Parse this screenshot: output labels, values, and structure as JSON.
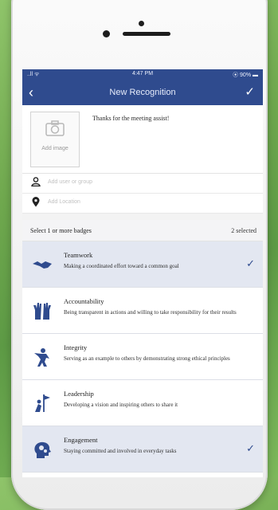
{
  "status_bar": {
    "signal": "..ll ᯤ",
    "time": "4:47 PM",
    "battery": "⦿ 90% ▬"
  },
  "nav": {
    "title": "New Recognition",
    "back_icon": "‹",
    "done_icon": "✓"
  },
  "compose": {
    "add_image_label": "Add image",
    "message": "Thanks for the meeting assist!"
  },
  "fields": {
    "user_placeholder": "Add user or group",
    "location_placeholder": "Add Location"
  },
  "badges_header": {
    "title": "Select 1 or more badges",
    "count": "2 selected"
  },
  "badges": [
    {
      "name": "Teamwork",
      "desc": "Making a coordinated effort toward a common goal",
      "selected": true,
      "icon": "handshake-icon"
    },
    {
      "name": "Accountability",
      "desc": "Being transparent in actions and willing to take responsibility for their results",
      "selected": false,
      "icon": "raised-hands-icon"
    },
    {
      "name": "Integrity",
      "desc": "Serving as an example to others by demonstrating strong ethical principles",
      "selected": false,
      "icon": "hero-icon"
    },
    {
      "name": "Leadership",
      "desc": "Developing a vision and inspiring others to share it",
      "selected": false,
      "icon": "flag-climber-icon"
    },
    {
      "name": "Engagement",
      "desc": "Staying committed and involved in everyday tasks",
      "selected": true,
      "icon": "gears-head-icon"
    }
  ],
  "colors": {
    "header": "#2f4b8e",
    "selected_row": "#e3e7f1",
    "accent": "#2f4b8e"
  }
}
